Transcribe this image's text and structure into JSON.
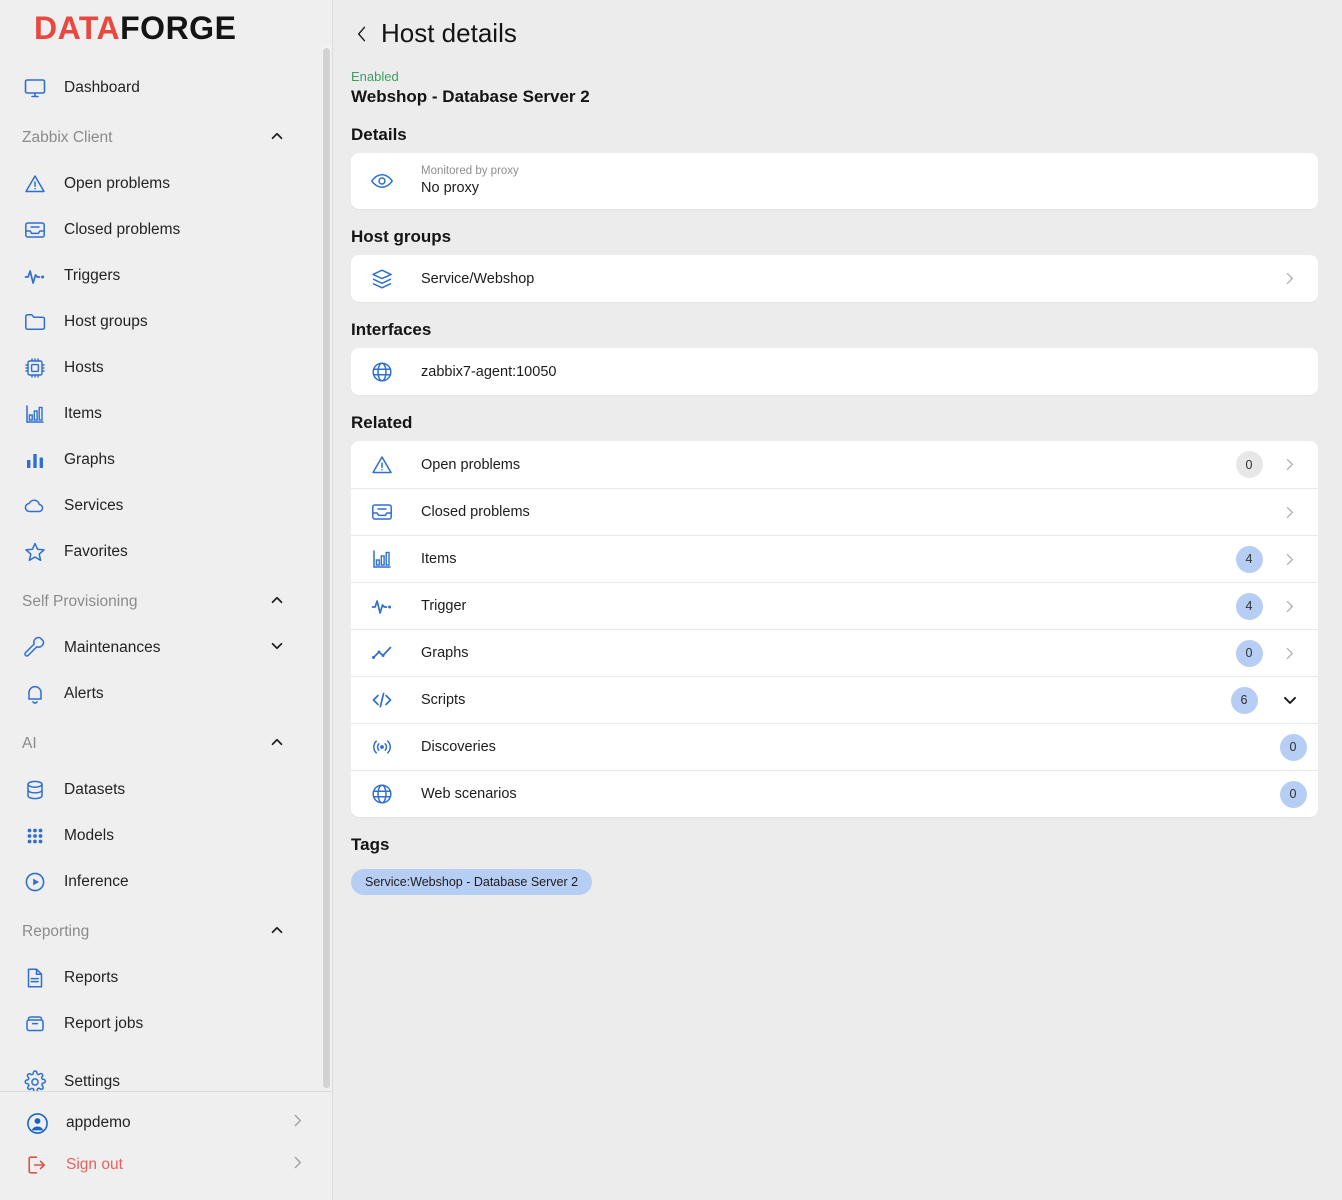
{
  "brand": {
    "part1": "DATA",
    "part2": "FORGE",
    "accent": "#e8483f",
    "dark": "#141414"
  },
  "sidebar": {
    "top_items": [
      {
        "label": "Dashboard",
        "icon": "monitor-icon"
      }
    ],
    "groups": [
      {
        "label": "Zabbix Client",
        "chevron": "chevron-up-icon",
        "items": [
          {
            "label": "Open problems",
            "icon": "warning-triangle-icon"
          },
          {
            "label": "Closed problems",
            "icon": "inbox-icon"
          },
          {
            "label": "Triggers",
            "icon": "pulse-icon"
          },
          {
            "label": "Host groups",
            "icon": "folder-icon"
          },
          {
            "label": "Hosts",
            "icon": "chip-icon"
          },
          {
            "label": "Items",
            "icon": "bar-chart-small-icon"
          },
          {
            "label": "Graphs",
            "icon": "bar-chart-icon"
          },
          {
            "label": "Services",
            "icon": "cloud-icon"
          },
          {
            "label": "Favorites",
            "icon": "star-icon"
          }
        ]
      },
      {
        "label": "Self Provisioning",
        "chevron": "chevron-up-icon",
        "items": [
          {
            "label": "Maintenances",
            "icon": "wrench-icon",
            "chevron": "chevron-down-icon"
          },
          {
            "label": "Alerts",
            "icon": "bell-icon"
          }
        ]
      },
      {
        "label": "AI",
        "chevron": "chevron-up-icon",
        "items": [
          {
            "label": "Datasets",
            "icon": "database-icon"
          },
          {
            "label": "Models",
            "icon": "grid-dots-icon"
          },
          {
            "label": "Inference",
            "icon": "play-circle-icon"
          }
        ]
      },
      {
        "label": "Reporting",
        "chevron": "chevron-up-icon",
        "items": [
          {
            "label": "Reports",
            "icon": "document-icon"
          },
          {
            "label": "Report jobs",
            "icon": "archive-icon"
          }
        ]
      }
    ],
    "bottom_items": [
      {
        "label": "Settings",
        "icon": "gear-icon"
      }
    ],
    "footer": [
      {
        "label": "appdemo",
        "icon": "user-circle-icon",
        "chevron": "chevron-right-icon",
        "kind": "user"
      },
      {
        "label": "Sign out",
        "icon": "logout-icon",
        "chevron": "chevron-right-icon",
        "kind": "signout",
        "color": "#e8635c"
      }
    ]
  },
  "page": {
    "back_icon": "chevron-left-icon",
    "title": "Host details",
    "status": "Enabled",
    "status_color": "#3f9d63",
    "host_name": "Webshop - Database Server 2"
  },
  "details": {
    "section_title": "Details",
    "rows": [
      {
        "icon": "eye-icon",
        "label": "Monitored by proxy",
        "value": "No proxy"
      }
    ]
  },
  "host_groups": {
    "section_title": "Host groups",
    "rows": [
      {
        "icon": "layers-icon",
        "label": "Service/Webshop",
        "chevron": "chevron-right-icon"
      }
    ]
  },
  "interfaces": {
    "section_title": "Interfaces",
    "rows": [
      {
        "icon": "globe-icon",
        "label": "zabbix7-agent:10050"
      }
    ]
  },
  "related": {
    "section_title": "Related",
    "rows": [
      {
        "icon": "warning-triangle-icon",
        "label": "Open problems",
        "badge": "0",
        "badge_style": "grey",
        "chevron": "chevron-right-icon"
      },
      {
        "icon": "inbox-icon",
        "label": "Closed problems",
        "badge": null,
        "badge_style": null,
        "chevron": "chevron-right-icon"
      },
      {
        "icon": "bar-chart-small-icon",
        "label": "Items",
        "badge": "4",
        "badge_style": "blue",
        "chevron": "chevron-right-icon"
      },
      {
        "icon": "pulse-icon",
        "label": "Trigger",
        "badge": "4",
        "badge_style": "blue",
        "chevron": "chevron-right-icon"
      },
      {
        "icon": "line-chart-icon",
        "label": "Graphs",
        "badge": "0",
        "badge_style": "blue",
        "chevron": "chevron-right-icon"
      },
      {
        "icon": "code-icon",
        "label": "Scripts",
        "badge": "6",
        "badge_style": "blue",
        "chevron": "chevron-down-bold-icon"
      },
      {
        "icon": "broadcast-icon",
        "label": "Discoveries",
        "badge": "0",
        "badge_style": "blue",
        "chevron": null
      },
      {
        "icon": "globe-icon",
        "label": "Web scenarios",
        "badge": "0",
        "badge_style": "blue",
        "chevron": null
      }
    ]
  },
  "tags": {
    "section_title": "Tags",
    "items": [
      "Service:Webshop - Database Server 2"
    ]
  }
}
